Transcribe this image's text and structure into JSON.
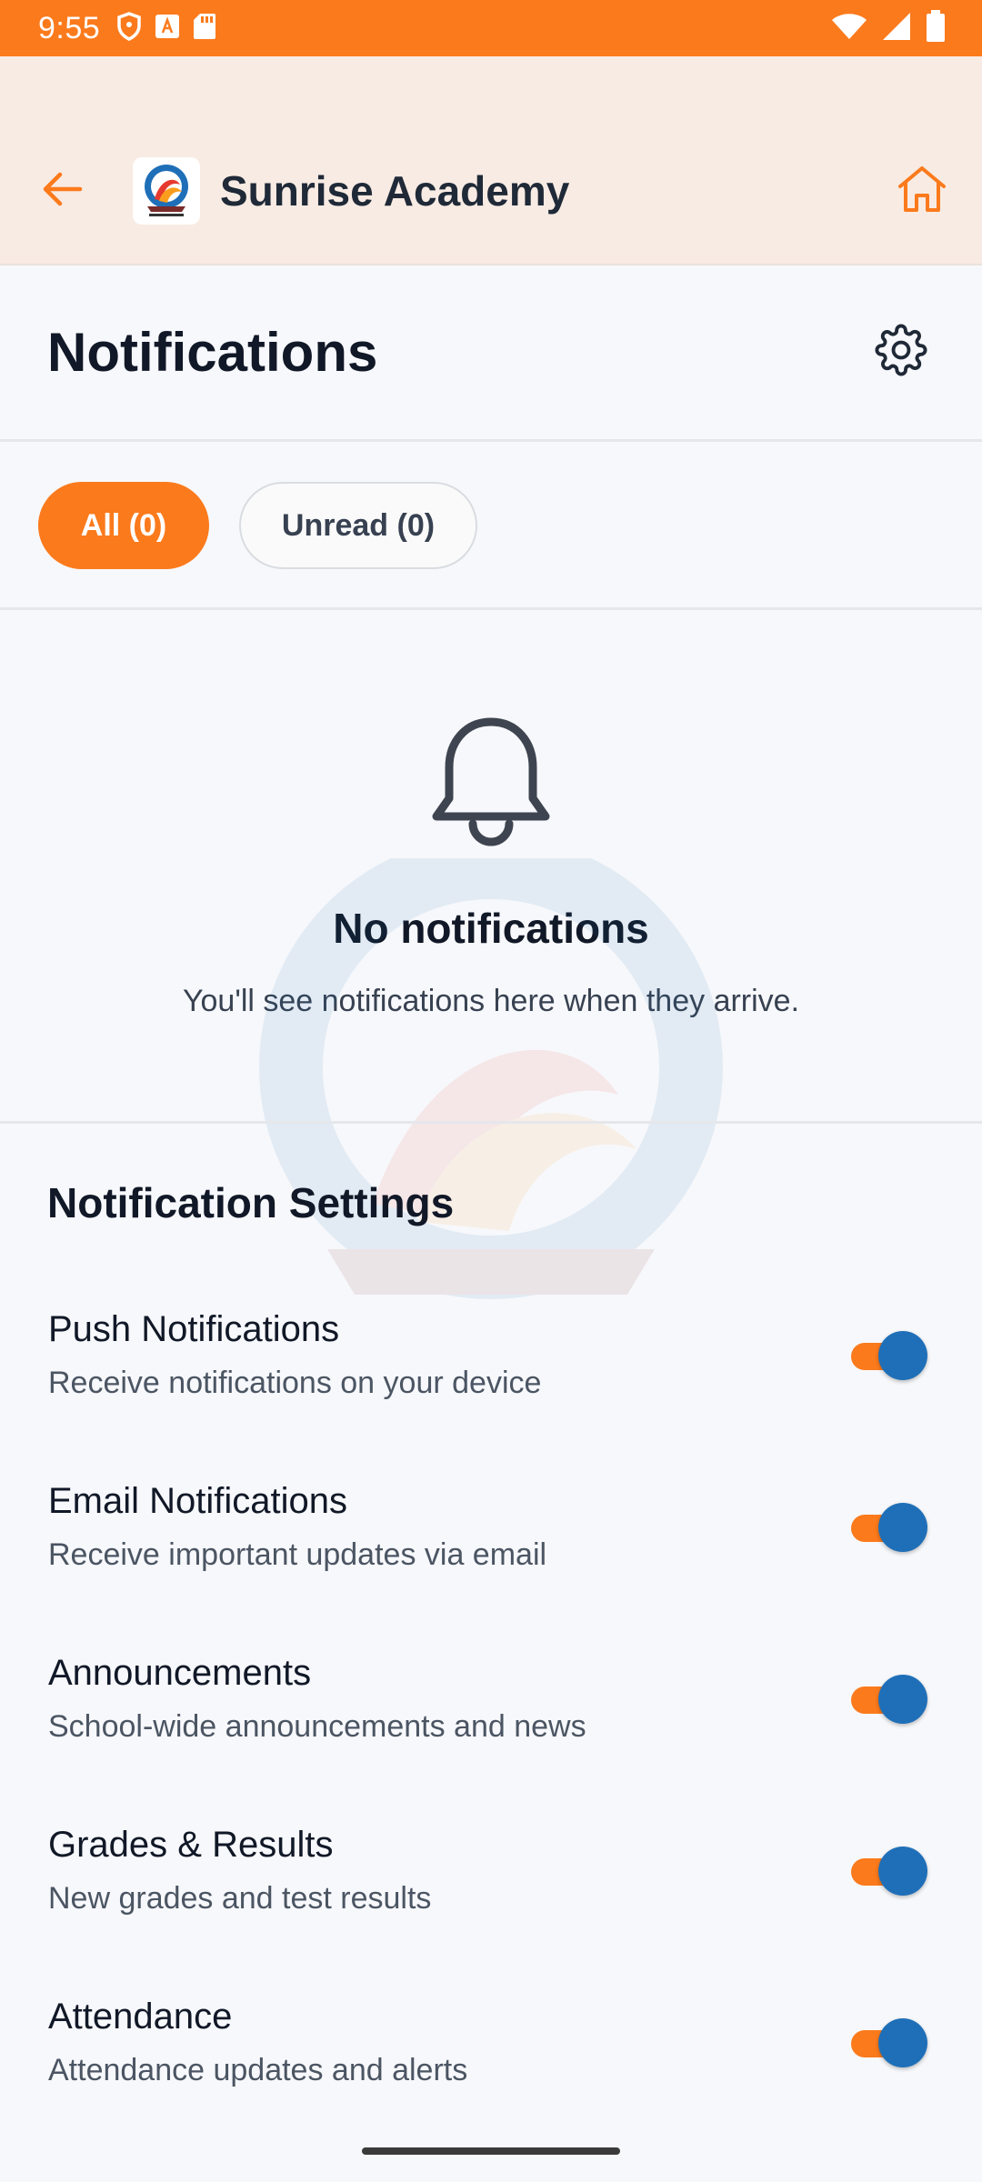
{
  "status_bar": {
    "time": "9:55",
    "icons_left": [
      "shield-icon",
      "a-badge-icon",
      "sd-card-icon"
    ],
    "icons_right": [
      "wifi-icon",
      "signal-icon",
      "battery-icon"
    ]
  },
  "app_bar": {
    "title": "Sunrise Academy",
    "back_icon": "arrow-left-icon",
    "home_icon": "home-icon"
  },
  "page": {
    "title": "Notifications",
    "settings_icon": "gear-icon"
  },
  "filters": {
    "all_label": "All (0)",
    "unread_label": "Unread (0)",
    "selected": "all"
  },
  "empty_state": {
    "icon": "bell-icon",
    "title": "No notifications",
    "subtitle": "You'll see notifications here when they arrive."
  },
  "settings": {
    "title": "Notification Settings",
    "items": [
      {
        "name": "Push Notifications",
        "description": "Receive notifications on your device",
        "enabled": true
      },
      {
        "name": "Email Notifications",
        "description": "Receive important updates via email",
        "enabled": true
      },
      {
        "name": "Announcements",
        "description": "School-wide announcements and news",
        "enabled": true
      },
      {
        "name": "Grades & Results",
        "description": "New grades and test results",
        "enabled": true
      },
      {
        "name": "Attendance",
        "description": "Attendance updates and alerts",
        "enabled": true
      }
    ]
  },
  "colors": {
    "accent": "#fb7a1c",
    "toggle_thumb": "#1f6fb8",
    "app_bar_bg": "#f8ebe3",
    "page_bg": "#f7f8fb"
  }
}
